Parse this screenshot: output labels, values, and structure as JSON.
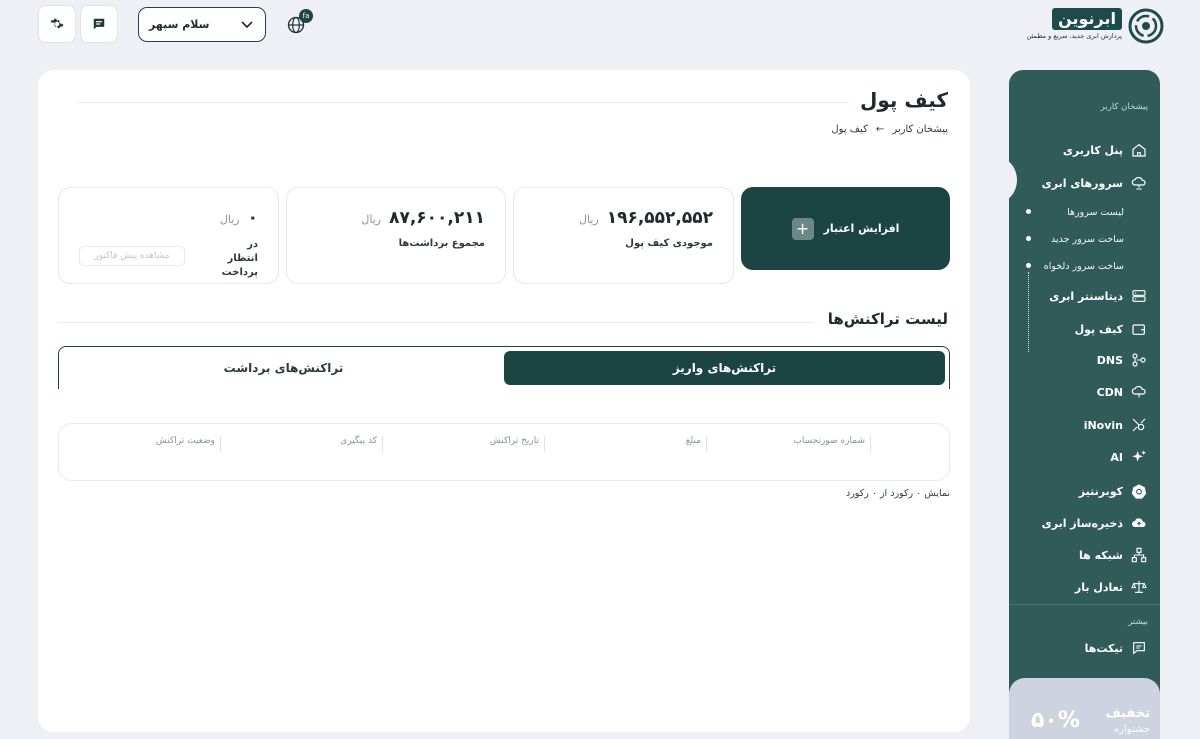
{
  "logo": {
    "brand": "ابرنوین",
    "tagline": "پردازش ابری جدید، سریع و مطمئن"
  },
  "topbar": {
    "user_name": "سلام سپهر",
    "lang_badge": "fa"
  },
  "sidebar": {
    "caption_main": "پیشخان کاربر",
    "caption_more": "بیشتر",
    "items": [
      {
        "label": "پنل کاربری",
        "icon": "home-icon"
      },
      {
        "label": "سرورهای ابری",
        "icon": "cloud-network-icon"
      },
      {
        "label": "دیتاسنتر ابری",
        "icon": "server-icon"
      },
      {
        "label": "کیف پول",
        "icon": "wallet-icon"
      },
      {
        "label": "DNS",
        "icon": "dns-icon"
      },
      {
        "label": "CDN",
        "icon": "cdn-icon"
      },
      {
        "label": "iNovin",
        "icon": "inovin-icon"
      },
      {
        "label": "AI",
        "icon": "sparkle-icon"
      },
      {
        "label": "کوبرنتیز",
        "icon": "kubernetes-icon"
      },
      {
        "label": "ذخیره‌ساز ابری",
        "icon": "cloud-upload-icon"
      },
      {
        "label": "شبکه ها",
        "icon": "network-icon"
      },
      {
        "label": "تعادل بار",
        "icon": "balance-icon"
      },
      {
        "label": "تیکت‌ها",
        "icon": "ticket-icon"
      }
    ],
    "subitems": [
      "لیست سرورها",
      "ساخت سرور جدید",
      "ساخت سرور دلخواه"
    ],
    "promo": {
      "title": "تخفیف",
      "subtitle": "جشنواره",
      "percent": "۵۰%"
    }
  },
  "main": {
    "title": "کیف پول",
    "breadcrumb": {
      "root": "پیشخان کاربر",
      "current": "کیف پول"
    },
    "add_credit_label": "افزایش اعتبار",
    "stats": [
      {
        "amount": "۱۹۶,۵۵۲,۵۵۲",
        "currency": "ریال",
        "caption": "موجودی کیف پول"
      },
      {
        "amount": "۸۷,۶۰۰,۲۱۱",
        "currency": "ریال",
        "caption": "مجموع برداشت‌ها"
      },
      {
        "amount": "۰",
        "currency": "ریال",
        "caption": "در انتظار پرداخت",
        "button": "مشاهده پیش فاکتور"
      }
    ],
    "section_title": "لیست تراکنش‌ها",
    "tabs": [
      "تراکنش‌های واریز",
      "تراکنش‌های برداشت"
    ],
    "table_headers": [
      "شماره صورتحساب",
      "مبلغ",
      "تاریخ تراکنش",
      "کد پیگیری",
      "وضعیت تراکنش"
    ],
    "summary": "نمایش ۰ رکورد از ۰ رکورد"
  },
  "colors": {
    "accent": "#1b4443",
    "sidebar": "#315b58",
    "background": "#eef0f5"
  }
}
